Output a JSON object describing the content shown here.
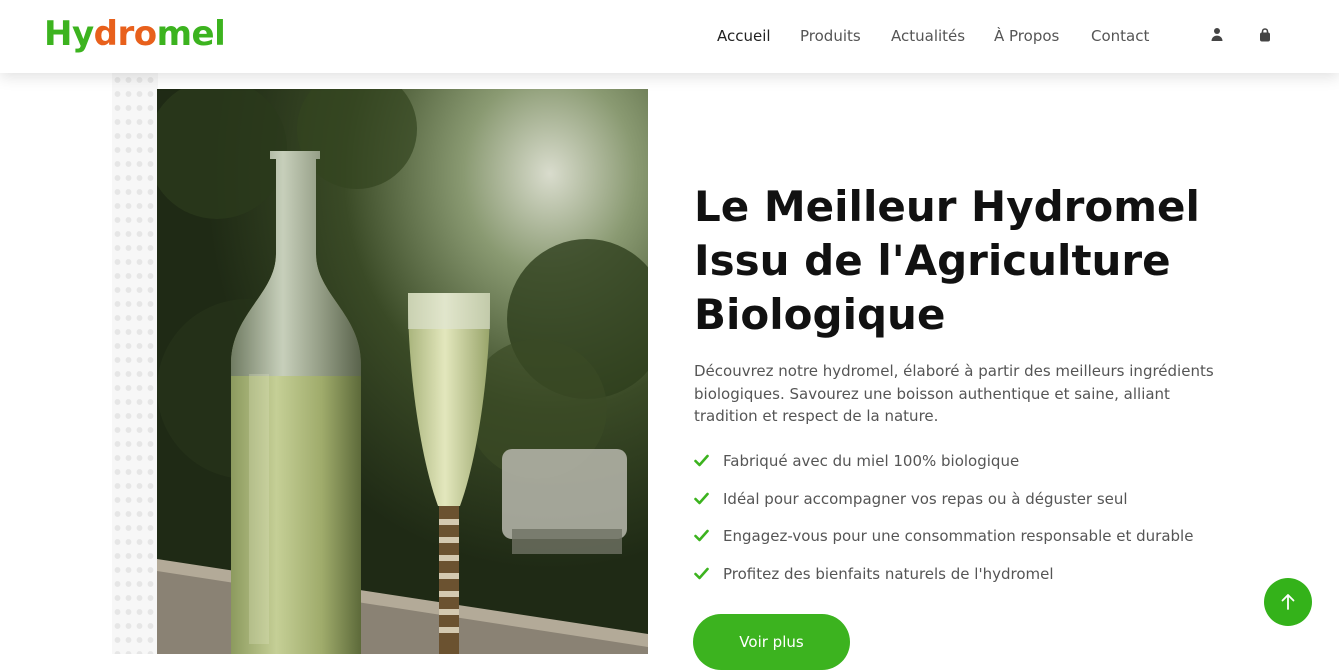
{
  "brand": {
    "part1": "Hy",
    "part2": "dro",
    "part3": "mel"
  },
  "nav": {
    "items": [
      {
        "label": "Accueil",
        "active": true
      },
      {
        "label": "Produits"
      },
      {
        "label": "Actualités"
      },
      {
        "label": "À Propos"
      },
      {
        "label": "Contact"
      }
    ],
    "icons": [
      "user-icon",
      "shopping-bag-icon"
    ]
  },
  "hero": {
    "title_lines": [
      "Le Meilleur Hydromel",
      "Issu de l'Agriculture",
      "Biologique"
    ],
    "description": "Découvrez notre hydromel, élaboré à partir des meilleurs ingrédients biologiques. Savourez une boisson authentique et saine, alliant tradition et respect de la nature.",
    "features": [
      "Fabriqué avec du miel 100% biologique",
      "Idéal pour accompagner vos repas ou à déguster seul",
      "Engagez-vous pour une consommation responsable et durable",
      "Profitez des bienfaits naturels de l'hydromel"
    ],
    "button_label": "Voir plus"
  },
  "colors": {
    "brand_green": "#3cb31f",
    "brand_orange": "#e8601c",
    "text_dark": "#111111",
    "text_muted": "#555555"
  },
  "icons": {
    "feature": "check-icon",
    "back_to_top": "arrow-up-icon"
  }
}
